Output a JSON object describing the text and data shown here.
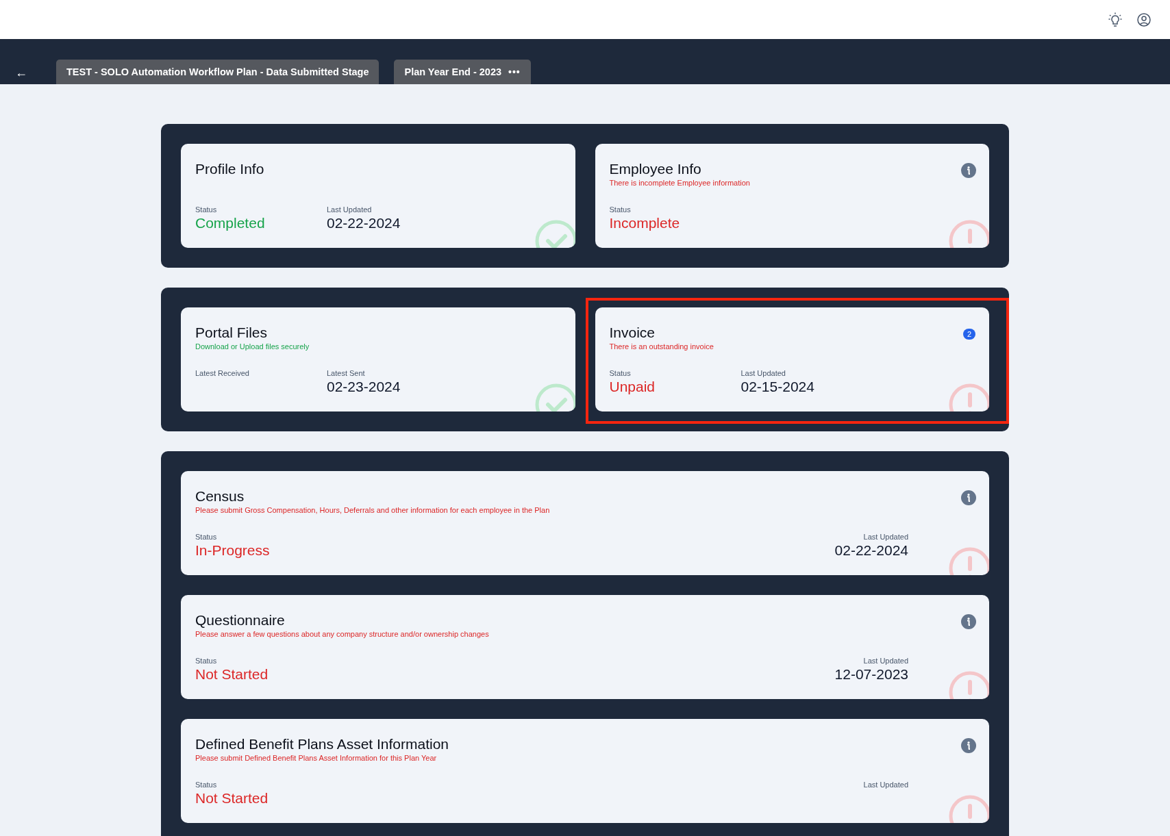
{
  "header": {
    "back": "←",
    "tabs": [
      {
        "label": "TEST - SOLO Automation Workflow Plan - Data Submitted Stage"
      },
      {
        "label": "Plan Year End - 2023",
        "menu": "•••"
      }
    ]
  },
  "panels": [
    {
      "kind": "grid",
      "cards": [
        {
          "title": "Profile Info",
          "kind": "complete",
          "info": false,
          "highlighted": false,
          "fields": [
            {
              "label": "Status",
              "value": "Completed",
              "color": "#16a34a"
            },
            {
              "label": "Last Updated",
              "value": "02-22-2024",
              "color": "#0f172a"
            }
          ]
        },
        {
          "title": "Employee Info",
          "subtitle": {
            "text": "There is incomplete Employee information",
            "color": "#dc2626"
          },
          "kind": "attention",
          "info": true,
          "highlighted": false,
          "fields": [
            {
              "label": "Status",
              "value": "Incomplete",
              "color": "#dc2626"
            }
          ]
        }
      ]
    },
    {
      "kind": "grid",
      "cards": [
        {
          "title": "Portal Files",
          "subtitle": {
            "text": "Download or Upload files securely",
            "color": "#16a34a"
          },
          "kind": "complete",
          "info": false,
          "highlighted": false,
          "fields": [
            {
              "label": "Latest Received"
            },
            {
              "label": "Latest Sent",
              "value": "02-23-2024",
              "color": "#0f172a"
            }
          ]
        },
        {
          "title": "Invoice",
          "subtitle": {
            "text": "There is an outstanding invoice",
            "color": "#dc2626"
          },
          "badge": "2",
          "kind": "attention",
          "info": false,
          "highlighted": true,
          "fields": [
            {
              "label": "Status",
              "value": "Unpaid",
              "color": "#dc2626"
            },
            {
              "label": "Last Updated",
              "value": "02-15-2024",
              "color": "#0f172a"
            }
          ]
        }
      ]
    },
    {
      "kind": "stack",
      "cards": [
        {
          "title": "Census",
          "subtitle": {
            "text": "Please submit Gross Compensation, Hours, Deferrals and other information for each employee in the Plan",
            "color": "#dc2626"
          },
          "kind": "attention",
          "info": true,
          "highlighted": false,
          "fields": [
            {
              "label": "Status",
              "value": "In-Progress",
              "color": "#dc2626"
            },
            {
              "label": "Last Updated",
              "value": "02-22-2024",
              "color": "#0f172a"
            }
          ]
        },
        {
          "title": "Questionnaire",
          "subtitle": {
            "text": "Please answer a few questions about any company structure and/or ownership changes",
            "color": "#dc2626"
          },
          "kind": "attention",
          "info": true,
          "highlighted": false,
          "fields": [
            {
              "label": "Status",
              "value": "Not Started",
              "color": "#dc2626"
            },
            {
              "label": "Last Updated",
              "value": "12-07-2023",
              "color": "#0f172a"
            }
          ]
        },
        {
          "title": "Defined Benefit Plans Asset Information",
          "subtitle": {
            "text": "Please submit Defined Benefit Plans Asset Information for this Plan Year",
            "color": "#dc2626"
          },
          "kind": "attention",
          "info": true,
          "highlighted": false,
          "fields": [
            {
              "label": "Status",
              "value": "Not Started",
              "color": "#dc2626"
            },
            {
              "label": "Last Updated"
            }
          ]
        }
      ]
    }
  ]
}
